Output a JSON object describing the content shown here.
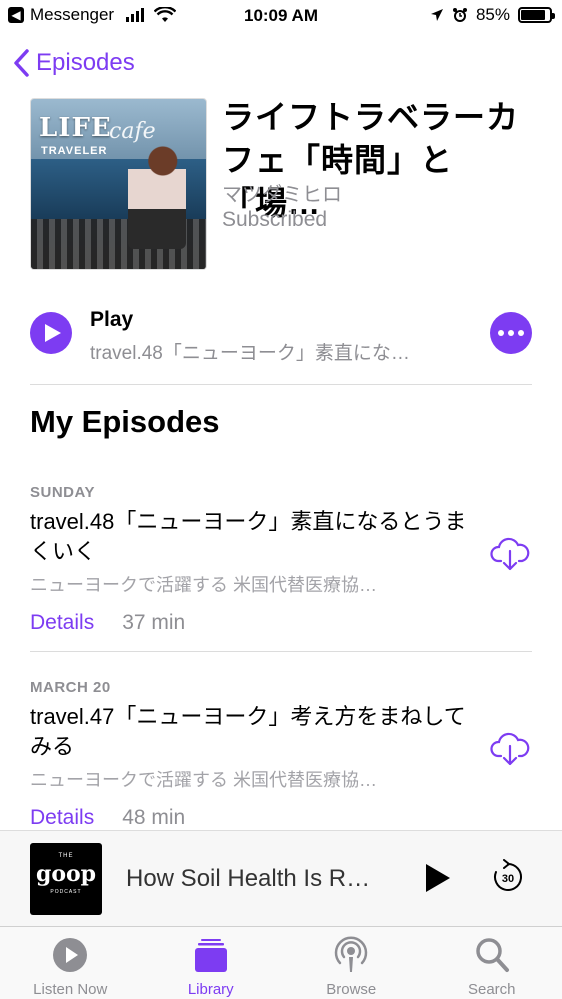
{
  "status_bar": {
    "back_app": "Messenger",
    "time": "10:09 AM",
    "battery_percent": "85%",
    "battery_level": 0.85
  },
  "nav": {
    "back_label": "Episodes"
  },
  "podcast": {
    "title": "ライフトラベラーカフェ「時間」と「場…",
    "author": "マツダミヒロ",
    "status": "Subscribed",
    "artwork_text": "LIFE TRAVELER"
  },
  "play_row": {
    "label": "Play",
    "subtitle": "travel.48「ニューヨーク」素直にな…"
  },
  "section_title": "My Episodes",
  "episodes": [
    {
      "date": "SUNDAY",
      "title": "travel.48「ニューヨーク」素直になるとうまくいく",
      "description": "ニューヨークで活躍する 米国代替医療協…",
      "details_label": "Details",
      "duration": "37 min"
    },
    {
      "date": "MARCH 20",
      "title": "travel.47「ニューヨーク」考え方をまねしてみる",
      "description": "ニューヨークで活躍する 米国代替医療協…",
      "details_label": "Details",
      "duration": "48 min"
    }
  ],
  "mini_player": {
    "artwork_top": "THE",
    "artwork_title": "goop",
    "artwork_bottom": "PODCAST",
    "title": "How Soil Health Is R…",
    "skip_seconds": "30"
  },
  "tabs": [
    {
      "label": "Listen Now",
      "icon": "play-circle-icon"
    },
    {
      "label": "Library",
      "icon": "library-icon",
      "active": true
    },
    {
      "label": "Browse",
      "icon": "podcast-icon"
    },
    {
      "label": "Search",
      "icon": "search-icon"
    }
  ],
  "colors": {
    "accent": "#7d3cf2",
    "secondary_text": "#8e8e93"
  }
}
